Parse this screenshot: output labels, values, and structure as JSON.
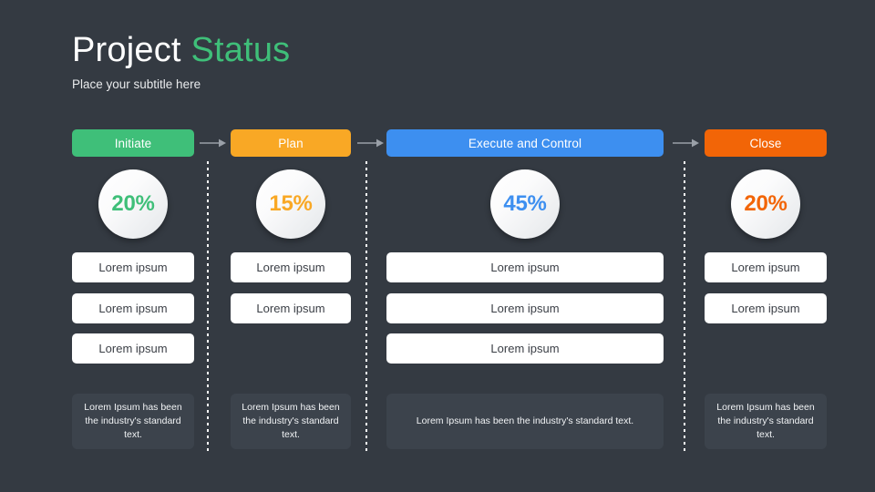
{
  "header": {
    "title_primary": "Project",
    "title_accent": "Status",
    "subtitle": "Place your subtitle here"
  },
  "colors": {
    "background": "#343a42",
    "initiate": "#3fbf79",
    "plan": "#f9a825",
    "execute": "#3d8ff0",
    "close": "#f26507",
    "arrow": "#9aa0a8",
    "pill_background": "#ffffff",
    "pill_text": "#3b3f46",
    "note_background": "#3c434c"
  },
  "arrows": [
    {
      "name": "arrow-initiate-to-plan"
    },
    {
      "name": "arrow-plan-to-execute"
    },
    {
      "name": "arrow-execute-to-close"
    }
  ],
  "columns": [
    {
      "id": "initiate",
      "label": "Initiate",
      "color": "#3fbf79",
      "percent": "20%",
      "items": [
        "Lorem ipsum",
        "Lorem ipsum",
        "Lorem ipsum"
      ],
      "note": "Lorem Ipsum has been the industry's standard text."
    },
    {
      "id": "plan",
      "label": "Plan",
      "color": "#f9a825",
      "percent": "15%",
      "items": [
        "Lorem ipsum",
        "Lorem ipsum"
      ],
      "note": "Lorem Ipsum has been the industry's standard text."
    },
    {
      "id": "execute-and-control",
      "label": "Execute and Control",
      "color": "#3d8ff0",
      "percent": "45%",
      "items": [
        "Lorem ipsum",
        "Lorem ipsum",
        "Lorem ipsum"
      ],
      "note": "Lorem Ipsum has been the industry's standard text."
    },
    {
      "id": "close",
      "label": "Close",
      "color": "#f26507",
      "percent": "20%",
      "items": [
        "Lorem ipsum",
        "Lorem ipsum"
      ],
      "note": "Lorem Ipsum has been the industry's standard text."
    }
  ]
}
